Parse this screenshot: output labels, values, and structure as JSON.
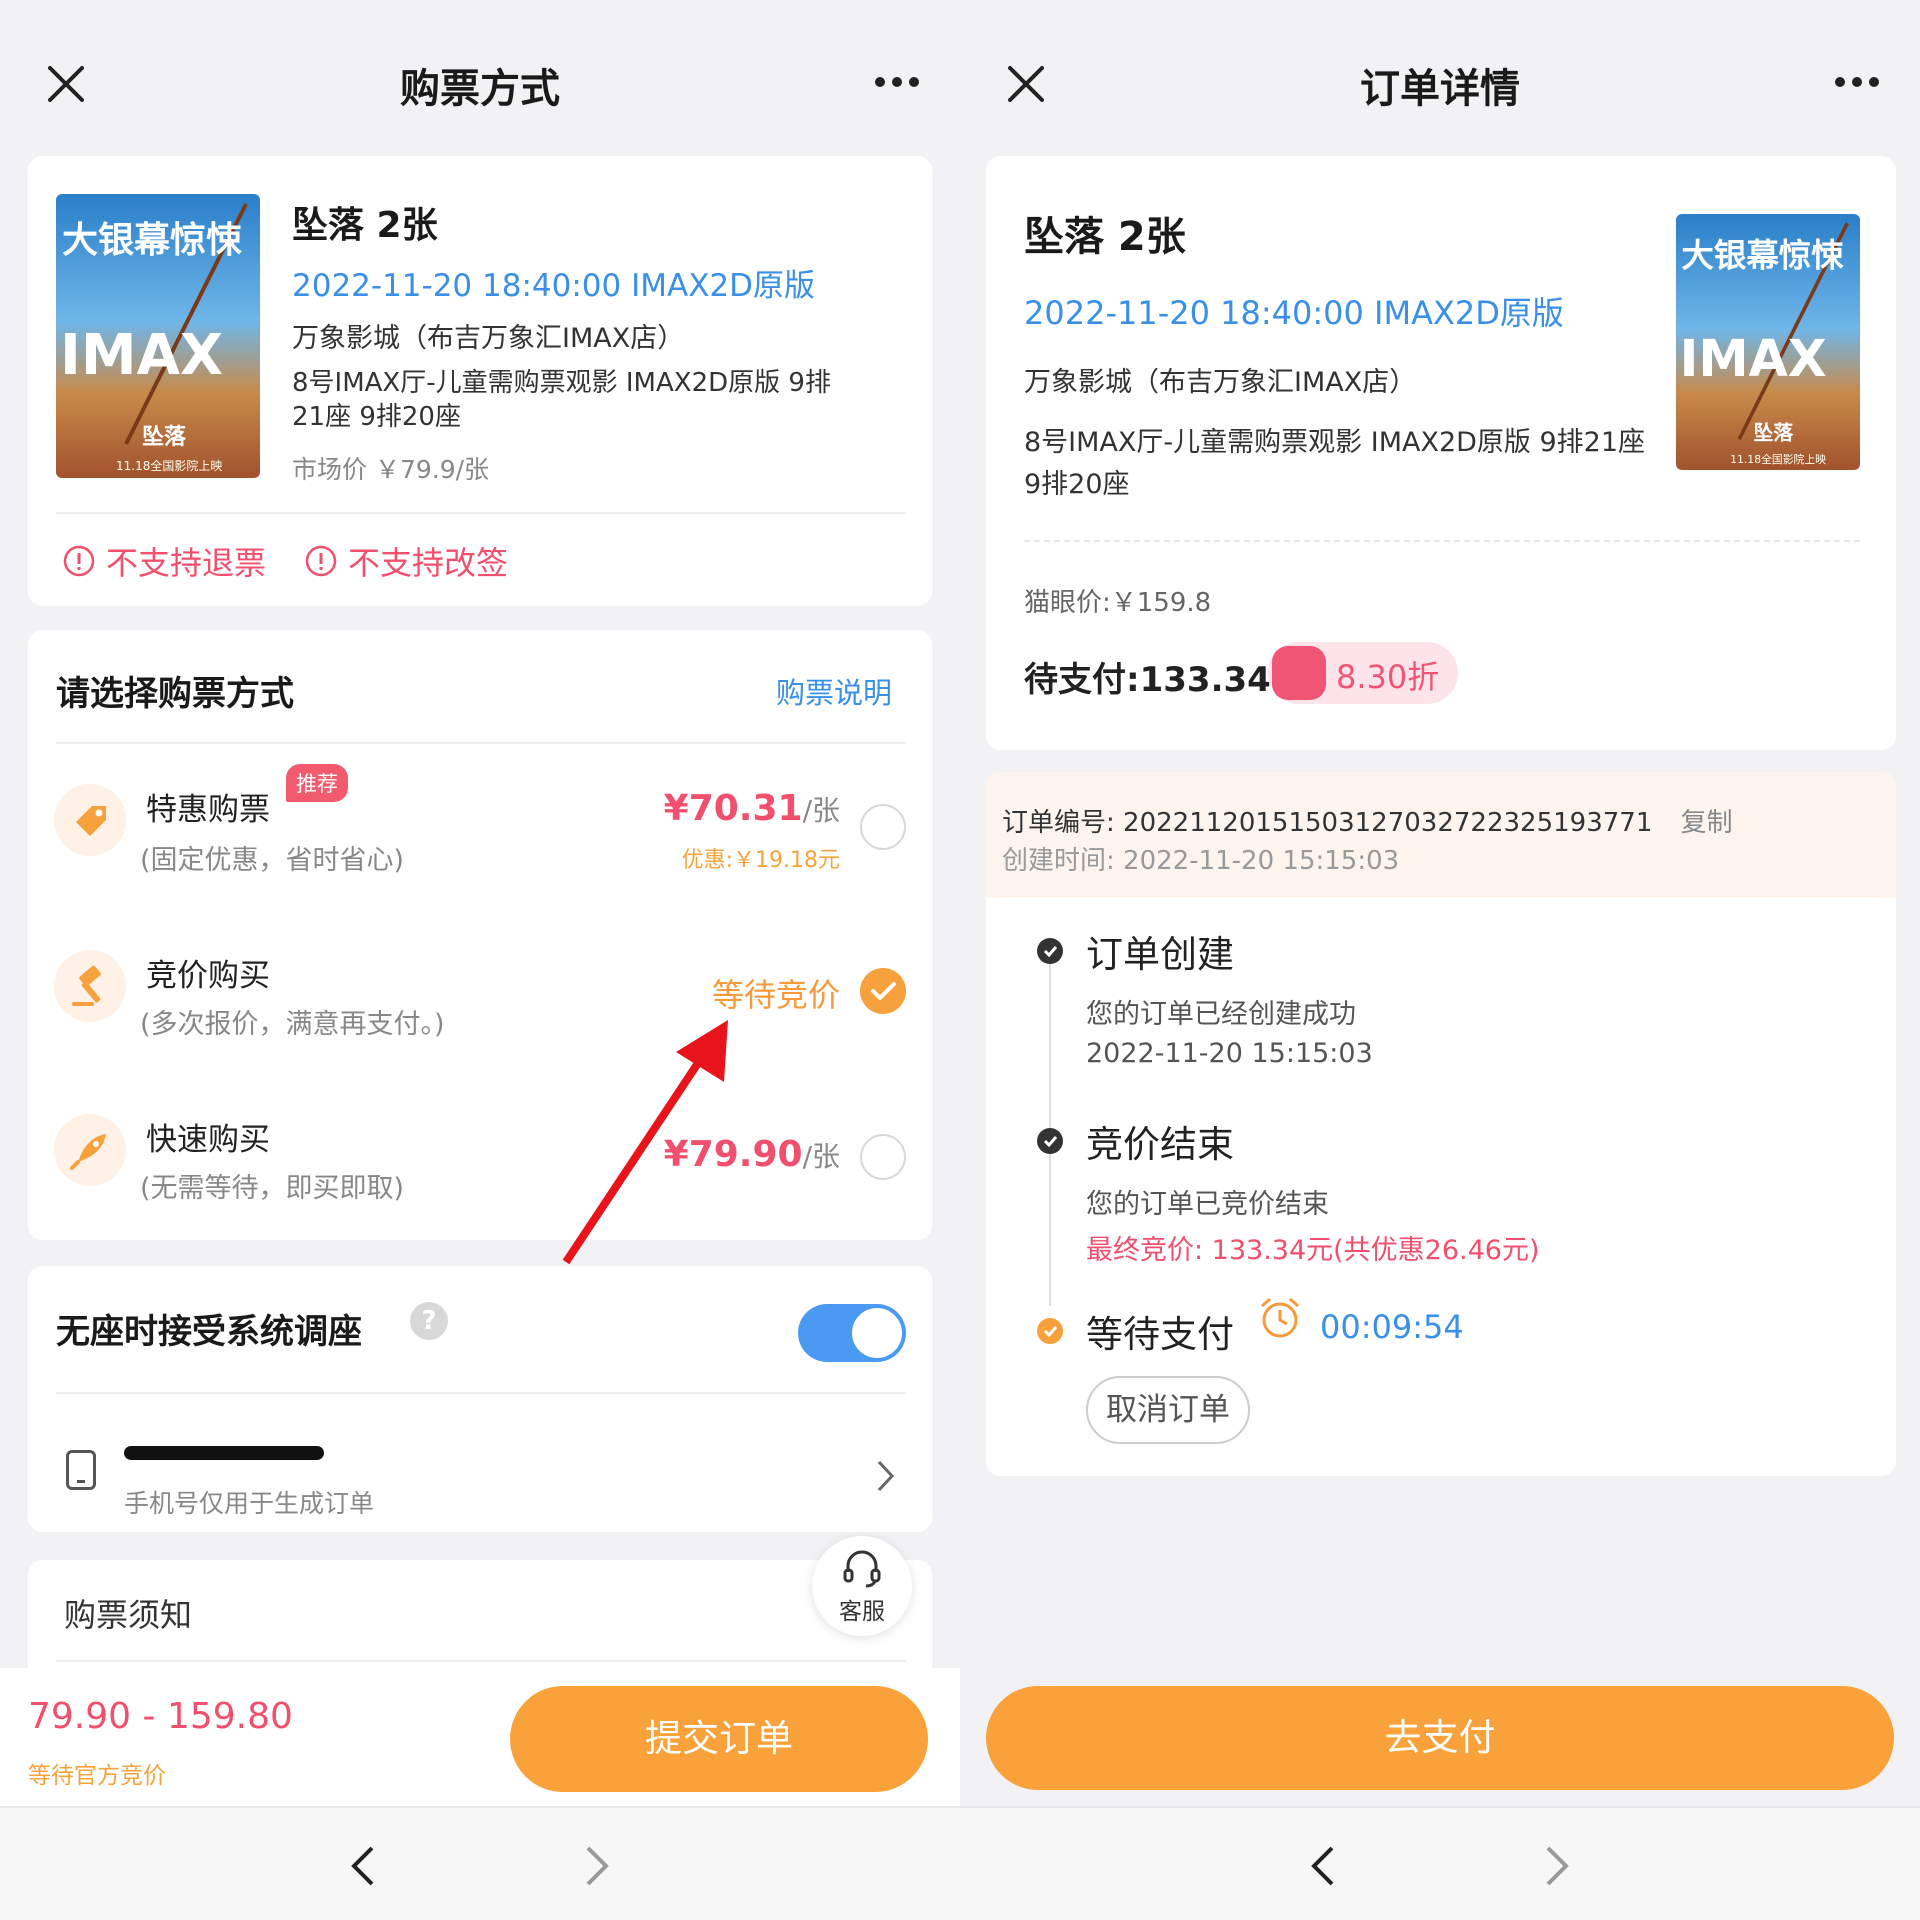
{
  "left": {
    "header": {
      "title": "购票方式"
    },
    "movie": {
      "title": "坠落 2张",
      "showtime": "2022-11-20 18:40:00 IMAX2D原版",
      "cinema": "万象影城（布吉万象汇IMAX店）",
      "seat_line1": "8号IMAX厅-儿童需购票观影 IMAX2D原版 9排",
      "seat_line2": "21座 9排20座",
      "market_price": "市场价 ￥79.9/张",
      "poster_text_top": "大银幕惊悚",
      "poster_text_mid": "IMAX",
      "poster_text_name": "坠落",
      "poster_text_date": "11.18全国影院上映"
    },
    "warnings": {
      "no_refund": "不支持退票",
      "no_change": "不支持改签"
    },
    "purchase": {
      "section_title": "请选择购票方式",
      "help_link": "购票说明",
      "options": [
        {
          "name": "特惠购票",
          "badge": "推荐",
          "desc": "(固定优惠，省时省心)",
          "price": "¥70.31",
          "unit": "/张",
          "discount": "优惠:￥19.18元",
          "selected": false,
          "icon": "tag-icon"
        },
        {
          "name": "竞价购买",
          "desc": "(多次报价，满意再支付。)",
          "status": "等待竞价",
          "selected": true,
          "icon": "gavel-icon"
        },
        {
          "name": "快速购买",
          "desc": "(无需等待，即买即取)",
          "price": "¥79.90",
          "unit": "/张",
          "selected": false,
          "icon": "rocket-icon"
        }
      ]
    },
    "seat_adjust": {
      "label": "无座时接受系统调座",
      "help": "?",
      "enabled": true
    },
    "phone": {
      "note": "手机号仅用于生成订单"
    },
    "customer_service": {
      "label": "客服"
    },
    "notice": {
      "title": "购票须知"
    },
    "bottom": {
      "price_range": "79.90 - 159.80",
      "status": "等待官方竞价",
      "submit_label": "提交订单"
    }
  },
  "right": {
    "header": {
      "title": "订单详情"
    },
    "movie": {
      "title": "坠落   2张",
      "showtime": "2022-11-20 18:40:00   IMAX2D原版",
      "cinema": "万象影城（布吉万象汇IMAX店）",
      "seat": "8号IMAX厅-儿童需购票观影 IMAX2D原版   9排21座   9排20座",
      "maoyan_price": "猫眼价:￥159.8",
      "to_pay": "待支付:133.34",
      "discount": "8.30折"
    },
    "order": {
      "number_label": "订单编号:",
      "number": "2022112015150312703272232519377​1",
      "copy_label": "复制",
      "created_label": "创建时间:",
      "created": "2022-11-20 15:15:03"
    },
    "timeline": [
      {
        "title": "订单创建",
        "desc": "您的订单已经创建成功",
        "time": "2022-11-20 15:15:03"
      },
      {
        "title": "竞价结束",
        "desc": "您的订单已竞价结束",
        "result": "最终竞价: 133.34元(共优惠26.46元)"
      },
      {
        "title": "等待支付",
        "countdown": "00:09:54",
        "cancel_label": "取消订单"
      }
    ],
    "bottom": {
      "pay_label": "去支付"
    }
  },
  "colors": {
    "accent_orange": "#f9a13a",
    "price_red": "#f0506e",
    "link_blue": "#3a8fe6",
    "toggle_blue": "#4a9af2",
    "annotation_red": "#e8141c"
  }
}
